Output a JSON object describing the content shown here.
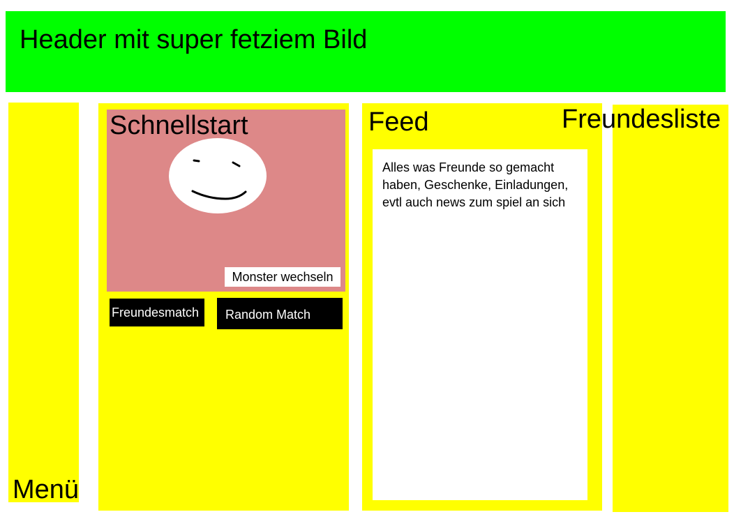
{
  "header": {
    "title": "Header mit super fetziem Bild",
    "background_color": "#00ff00"
  },
  "menu": {
    "label": "Menü",
    "background_color": "#ffff00"
  },
  "schnellstart": {
    "title": "Schnellstart",
    "panel_color": "#dd8888",
    "monster_icon": "smiley-face-icon",
    "monster_switch_label": "Monster wechseln",
    "friend_match_label": "Freundesmatch",
    "random_match_label": "Random Match"
  },
  "feed": {
    "title": "Feed",
    "content_text": "Alles was Freunde so gemacht haben, Geschenke, Einladungen, evtl auch news zum spiel an sich"
  },
  "friends": {
    "title": "Freundesliste"
  }
}
